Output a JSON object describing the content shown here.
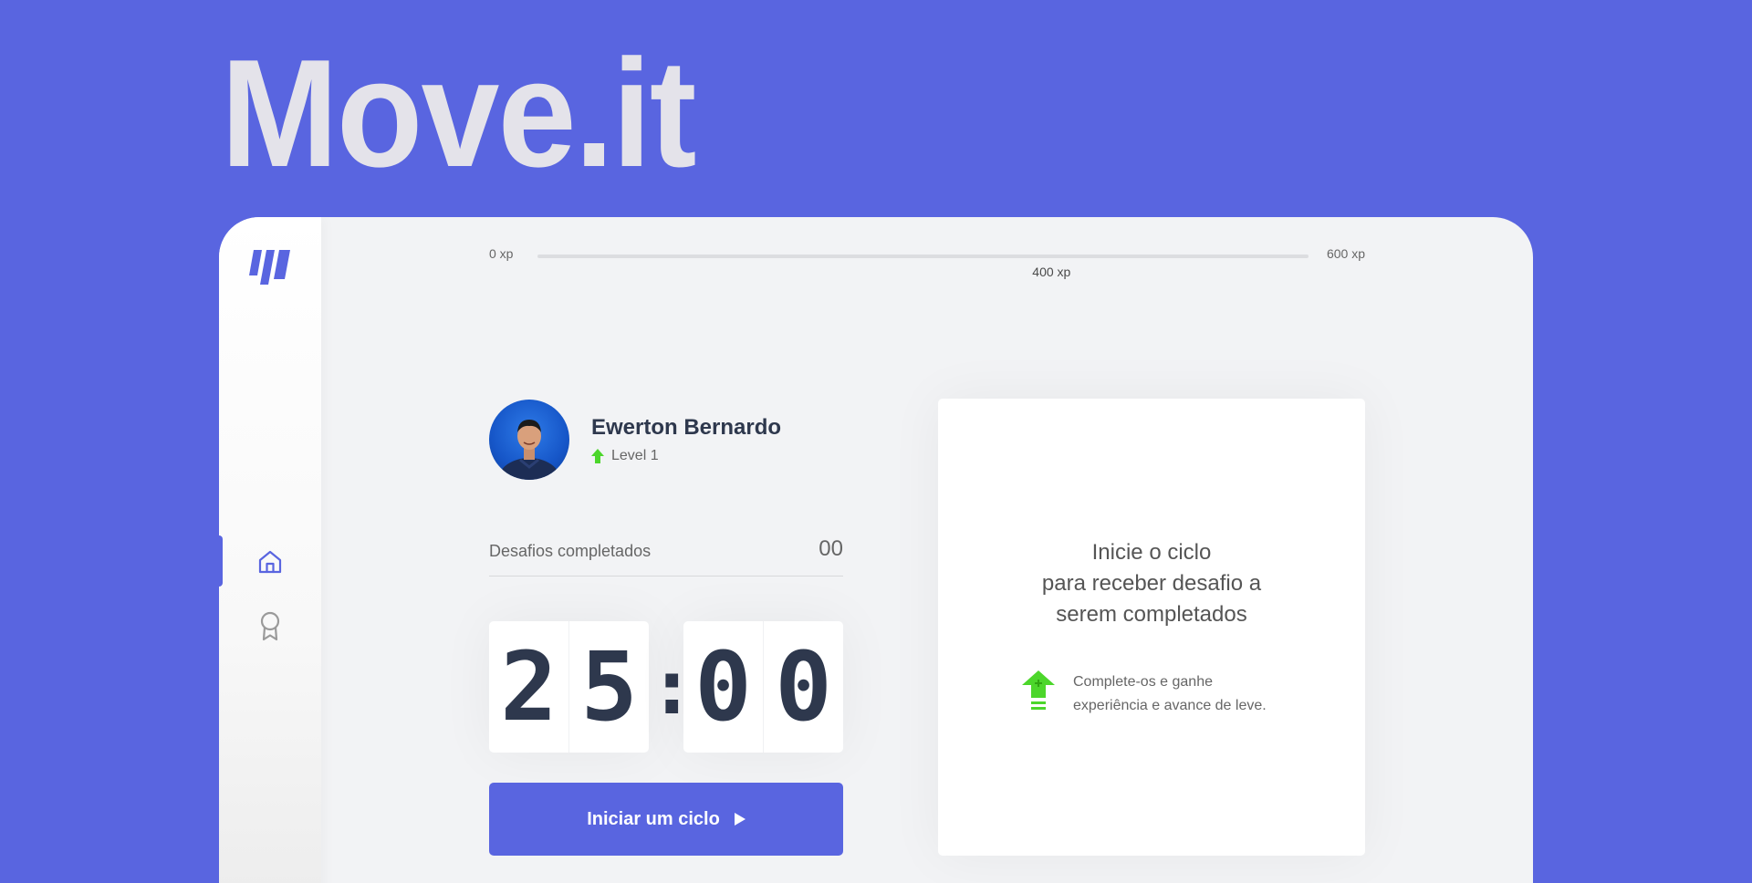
{
  "brand": {
    "title": "Move.it",
    "accent_color": "#5965e0"
  },
  "sidebar": {
    "logo": "move-it-logo",
    "items": [
      {
        "name": "home",
        "icon": "home-icon",
        "active": true
      },
      {
        "name": "awards",
        "icon": "award-icon",
        "active": false
      }
    ]
  },
  "experience": {
    "min_label": "0 xp",
    "max_label": "600 xp",
    "current_label": "400 xp",
    "current_xp": 400,
    "max_xp": 600,
    "fill_fraction": 0
  },
  "profile": {
    "name": "Ewerton Bernardo",
    "level_label": "Level 1",
    "level_icon": "level-up-arrow-icon",
    "avatar_icon": "user-photo"
  },
  "completed": {
    "label": "Desafios completados",
    "count": "00"
  },
  "countdown": {
    "minutes_left": "2",
    "minutes_right": "5",
    "separator": ":",
    "seconds_left": "0",
    "seconds_right": "0"
  },
  "start_button": {
    "label": "Iniciar um ciclo",
    "icon": "play-icon"
  },
  "challenge_box": {
    "title_line1": "Inicie o ciclo",
    "title_line2": "para receber desafio a",
    "title_line3": "serem completados",
    "hint_line1": "Complete-os e ganhe",
    "hint_line2": "experiência e avance de leve.",
    "hint_icon": "level-up-icon",
    "hint_color": "#4cd62b"
  }
}
